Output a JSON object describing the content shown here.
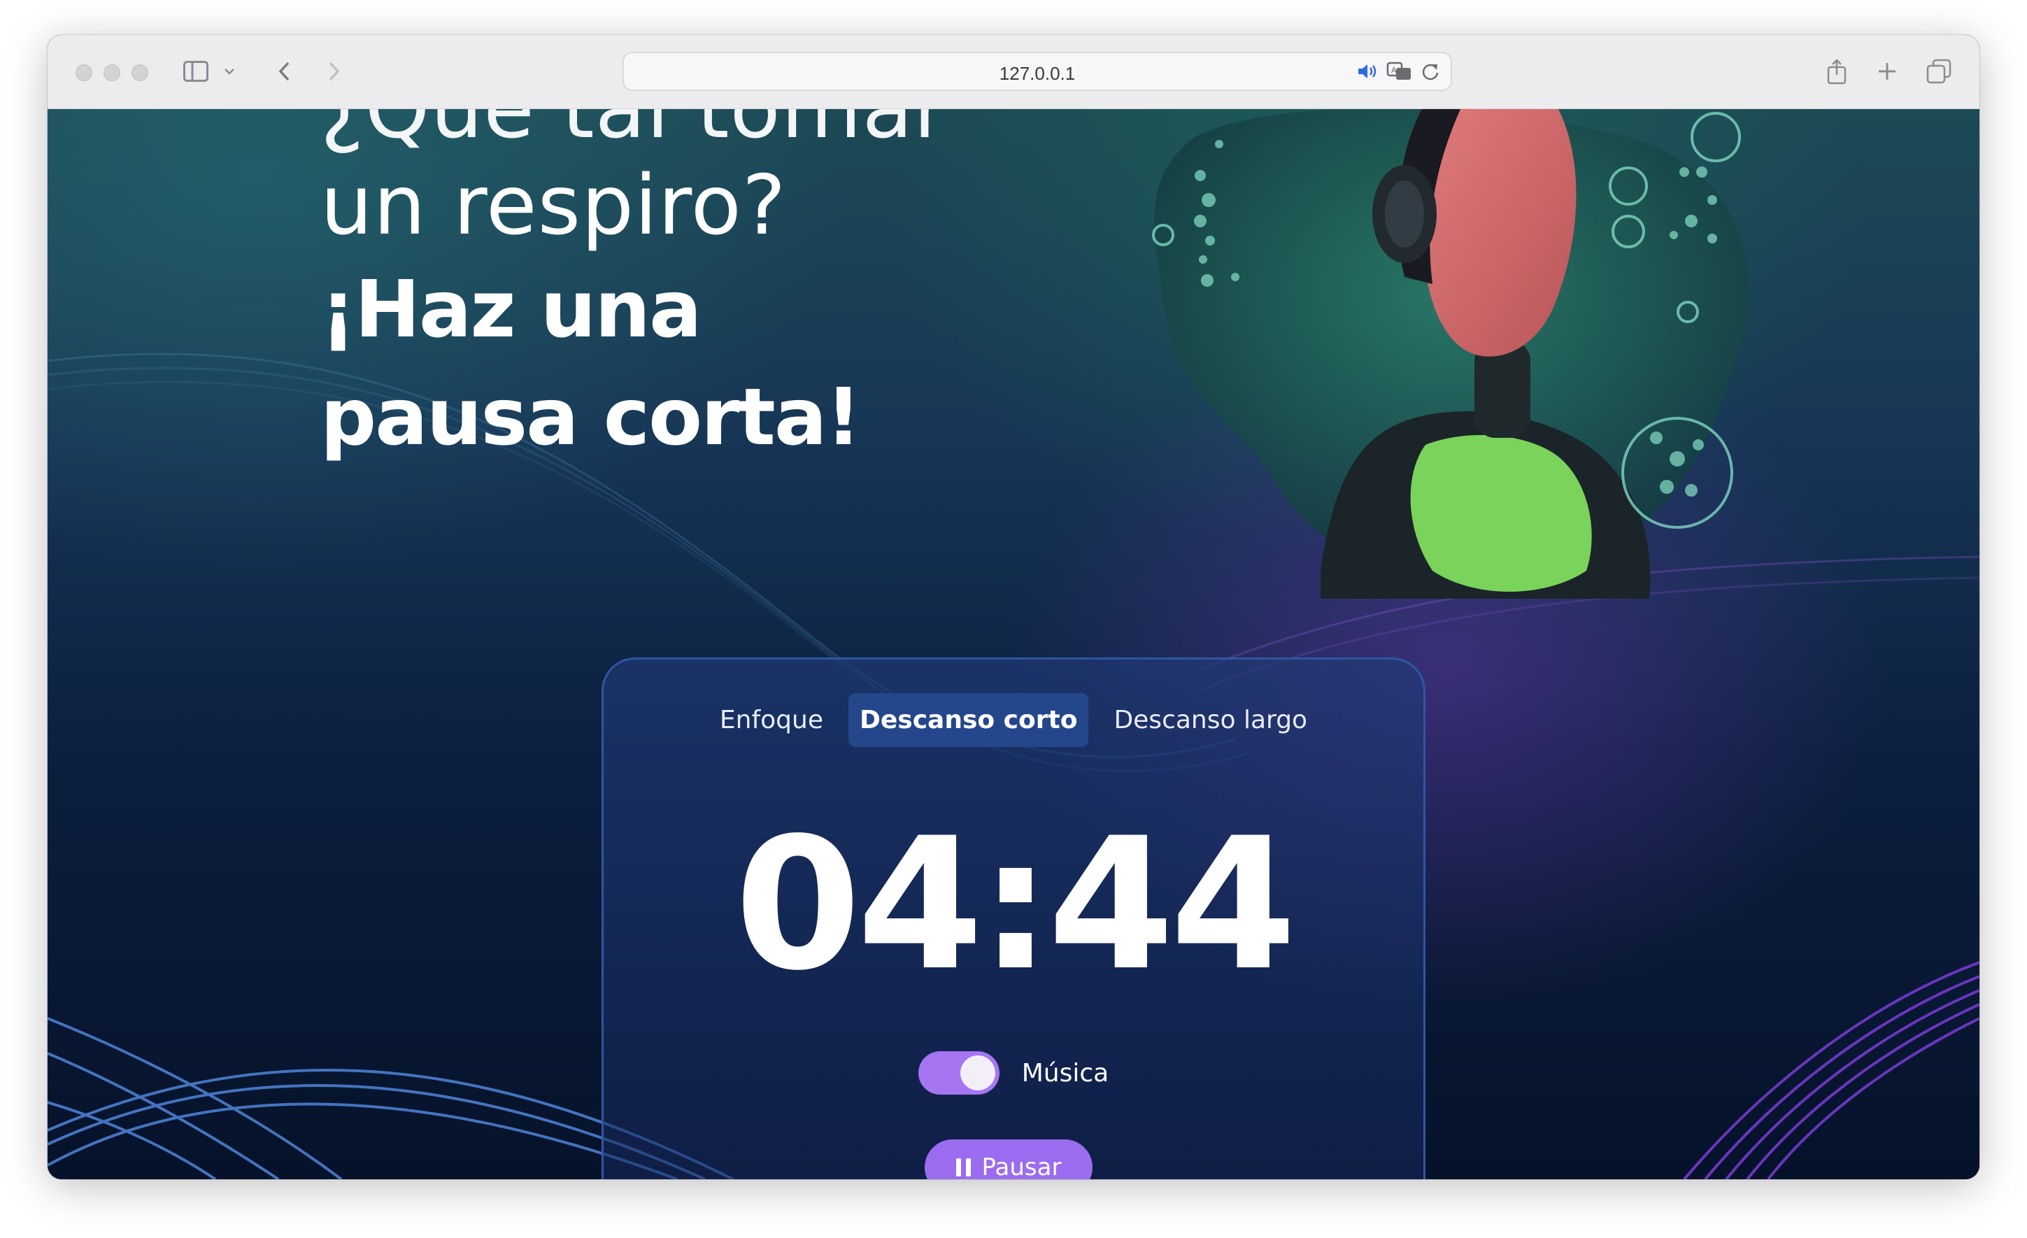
{
  "browser": {
    "url": "127.0.0.1",
    "icons": [
      "sidebar-icon",
      "chevron-down-icon",
      "back-icon",
      "forward-icon",
      "speaker-icon",
      "translate-icon",
      "reload-icon",
      "share-icon",
      "new-tab-icon",
      "tabs-overview-icon"
    ]
  },
  "hero": {
    "line_partial": "¿Qué tal tomar",
    "line_light": "un respiro?",
    "line_bold_1": "¡Haz una",
    "line_bold_2": "pausa corta!"
  },
  "timer_card": {
    "tabs": [
      {
        "label": "Enfoque",
        "active": false
      },
      {
        "label": "Descanso corto",
        "active": true
      },
      {
        "label": "Descanso largo",
        "active": false
      }
    ],
    "time": "04:44",
    "music_label": "Música",
    "music_on": true,
    "pause_label": "Pausar"
  },
  "colors": {
    "accent_purple": "#a575f2",
    "active_tab": "#24478c",
    "card_border": "#2f56a3"
  }
}
